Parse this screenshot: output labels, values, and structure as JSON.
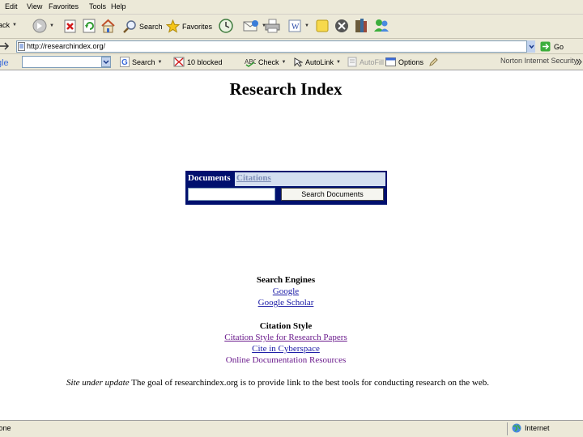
{
  "menubar": {
    "items": [
      "Edit",
      "View",
      "Favorites",
      "Tools",
      "Help"
    ]
  },
  "toolbar": {
    "back_label": "Back",
    "search_label": "Search",
    "favorites_label": "Favorites"
  },
  "address": {
    "url": "http://researchindex.org/",
    "go_label": "Go"
  },
  "googlebar": {
    "search_label": "Search",
    "blocked_label": "10 blocked",
    "check_label": "Check",
    "autolink_label": "AutoLink",
    "autofill_label": "AutoFill",
    "options_label": "Options",
    "norton_label": "Norton Internet Security"
  },
  "page": {
    "title": "Research Index",
    "search": {
      "tab_documents": "Documents",
      "tab_citations": "Citations",
      "button_label": "Search Documents"
    },
    "search_engines": {
      "heading": "Search Engines",
      "links": [
        "Google",
        "Google Scholar"
      ]
    },
    "citation_style": {
      "heading": "Citation Style",
      "links": [
        "Citation Style for Research Papers",
        "Cite in Cyberspace",
        "Online Documentation Resources"
      ]
    },
    "notice": {
      "italic": "Site under update",
      "text": " The goal of researchindex.org is to provide link to the best tools for conducting research on the web."
    }
  },
  "statusbar": {
    "text": "Done",
    "zone": "Internet"
  },
  "colors": {
    "navy": "#00106e",
    "link": "#1a1aa6",
    "visited": "#6a1a8c",
    "chrome": "#ece9d8"
  }
}
